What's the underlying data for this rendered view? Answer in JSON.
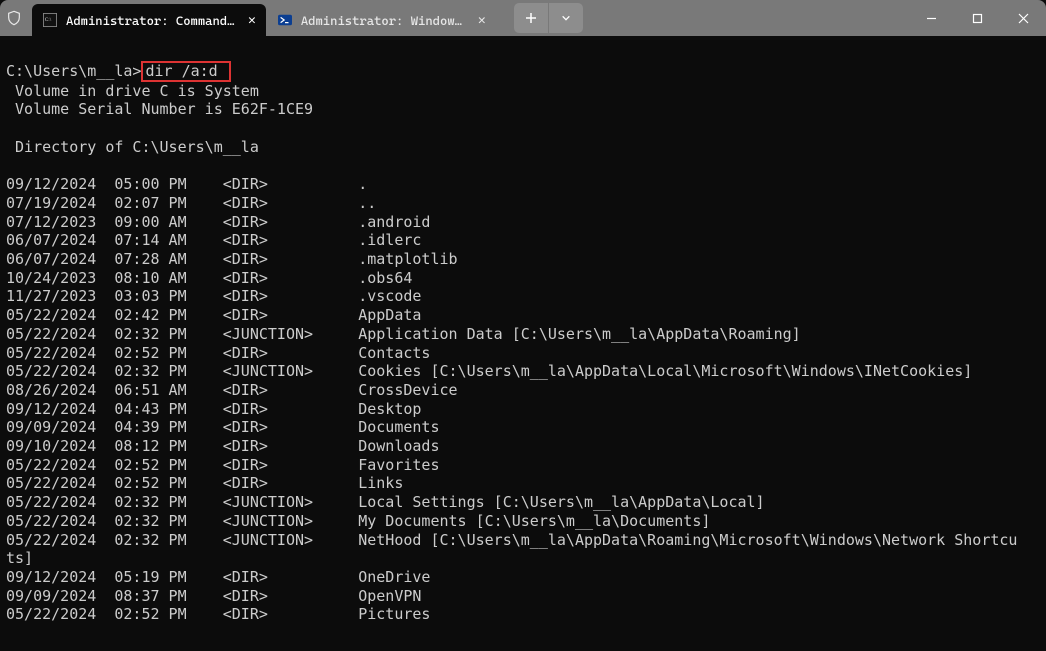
{
  "titlebar": {
    "tabs": [
      {
        "label": "Administrator: Command Pro",
        "icon": "cmd"
      },
      {
        "label": "Administrator: Windows Power",
        "icon": "ps"
      }
    ]
  },
  "terminal": {
    "prompt_path": "C:\\Users\\m__la",
    "command": "dir /a:d",
    "vol_line": " Volume in drive C is System",
    "serial_line": " Volume Serial Number is E62F-1CE9",
    "dir_of_line": " Directory of C:\\Users\\m__la",
    "entries": [
      {
        "date": "09/12/2024",
        "time": "05:00 PM",
        "type": "<DIR>",
        "name": "."
      },
      {
        "date": "07/19/2024",
        "time": "02:07 PM",
        "type": "<DIR>",
        "name": ".."
      },
      {
        "date": "07/12/2023",
        "time": "09:00 AM",
        "type": "<DIR>",
        "name": ".android"
      },
      {
        "date": "06/07/2024",
        "time": "07:14 AM",
        "type": "<DIR>",
        "name": ".idlerc"
      },
      {
        "date": "06/07/2024",
        "time": "07:28 AM",
        "type": "<DIR>",
        "name": ".matplotlib"
      },
      {
        "date": "10/24/2023",
        "time": "08:10 AM",
        "type": "<DIR>",
        "name": ".obs64"
      },
      {
        "date": "11/27/2023",
        "time": "03:03 PM",
        "type": "<DIR>",
        "name": ".vscode"
      },
      {
        "date": "05/22/2024",
        "time": "02:42 PM",
        "type": "<DIR>",
        "name": "AppData"
      },
      {
        "date": "05/22/2024",
        "time": "02:32 PM",
        "type": "<JUNCTION>",
        "name": "Application Data [C:\\Users\\m__la\\AppData\\Roaming]"
      },
      {
        "date": "05/22/2024",
        "time": "02:52 PM",
        "type": "<DIR>",
        "name": "Contacts"
      },
      {
        "date": "05/22/2024",
        "time": "02:32 PM",
        "type": "<JUNCTION>",
        "name": "Cookies [C:\\Users\\m__la\\AppData\\Local\\Microsoft\\Windows\\INetCookies]"
      },
      {
        "date": "08/26/2024",
        "time": "06:51 AM",
        "type": "<DIR>",
        "name": "CrossDevice"
      },
      {
        "date": "09/12/2024",
        "time": "04:43 PM",
        "type": "<DIR>",
        "name": "Desktop"
      },
      {
        "date": "09/09/2024",
        "time": "04:39 PM",
        "type": "<DIR>",
        "name": "Documents"
      },
      {
        "date": "09/10/2024",
        "time": "08:12 PM",
        "type": "<DIR>",
        "name": "Downloads"
      },
      {
        "date": "05/22/2024",
        "time": "02:52 PM",
        "type": "<DIR>",
        "name": "Favorites"
      },
      {
        "date": "05/22/2024",
        "time": "02:52 PM",
        "type": "<DIR>",
        "name": "Links"
      },
      {
        "date": "05/22/2024",
        "time": "02:32 PM",
        "type": "<JUNCTION>",
        "name": "Local Settings [C:\\Users\\m__la\\AppData\\Local]"
      },
      {
        "date": "05/22/2024",
        "time": "02:32 PM",
        "type": "<JUNCTION>",
        "name": "My Documents [C:\\Users\\m__la\\Documents]"
      },
      {
        "date": "05/22/2024",
        "time": "02:32 PM",
        "type": "<JUNCTION>",
        "name": "NetHood [C:\\Users\\m__la\\AppData\\Roaming\\Microsoft\\Windows\\Network Shortcu",
        "wrap": "ts]"
      },
      {
        "date": "09/12/2024",
        "time": "05:19 PM",
        "type": "<DIR>",
        "name": "OneDrive"
      },
      {
        "date": "09/09/2024",
        "time": "08:37 PM",
        "type": "<DIR>",
        "name": "OpenVPN"
      },
      {
        "date": "05/22/2024",
        "time": "02:52 PM",
        "type": "<DIR>",
        "name": "Pictures"
      }
    ]
  }
}
